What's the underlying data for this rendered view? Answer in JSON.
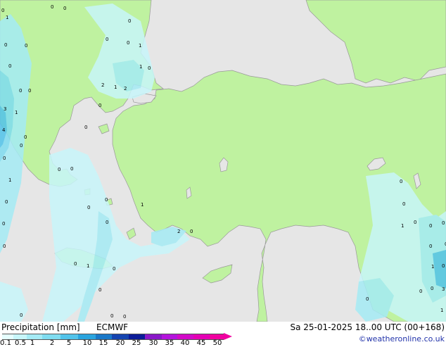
{
  "title": "Precipitation [mm]",
  "model": "ECMWF",
  "valid_time": "Sa 25-01-2025 18..00 UTC (00+168)",
  "credit": "©weatheronline.co.uk",
  "legend": {
    "ticks": [
      "0.1",
      "0.5",
      "1",
      "2",
      "5",
      "10",
      "15",
      "20",
      "25",
      "30",
      "35",
      "40",
      "45",
      "50"
    ],
    "colors": [
      "#e6ffff",
      "#c8f6fa",
      "#a5ebf5",
      "#7fdcf0",
      "#52c3ea",
      "#2aa4de",
      "#1a78c8",
      "#1544b0",
      "#0c1c98",
      "#8a18c8",
      "#b414dc",
      "#d20ac8",
      "#e400b4",
      "#f000a0"
    ]
  },
  "map_labels": [
    {
      "t": "0"
    },
    {
      "t": "0"
    },
    {
      "t": "1"
    },
    {
      "t": "0"
    },
    {
      "t": "0"
    },
    {
      "t": "0"
    },
    {
      "t": "1"
    },
    {
      "t": "0"
    },
    {
      "t": "0"
    },
    {
      "t": "0"
    },
    {
      "t": "1"
    },
    {
      "t": "0"
    },
    {
      "t": "2"
    },
    {
      "t": "1"
    },
    {
      "t": "2"
    },
    {
      "t": "0"
    },
    {
      "t": "3"
    },
    {
      "t": "1"
    },
    {
      "t": "4"
    },
    {
      "t": "0"
    },
    {
      "t": "0"
    },
    {
      "t": "0"
    },
    {
      "t": "0"
    },
    {
      "t": "1"
    },
    {
      "t": "0"
    },
    {
      "t": "0"
    },
    {
      "t": "0"
    },
    {
      "t": "0"
    },
    {
      "t": "0"
    },
    {
      "t": "0"
    },
    {
      "t": "0"
    },
    {
      "t": "0"
    },
    {
      "t": "1"
    },
    {
      "t": "1"
    },
    {
      "t": "0"
    },
    {
      "t": "0"
    },
    {
      "t": "2"
    },
    {
      "t": "0"
    },
    {
      "t": "0"
    },
    {
      "t": "0"
    },
    {
      "t": "1"
    },
    {
      "t": "0"
    },
    {
      "t": "0"
    },
    {
      "t": "0"
    },
    {
      "t": "0"
    },
    {
      "t": "0"
    },
    {
      "t": "0"
    },
    {
      "t": "0"
    },
    {
      "t": "0"
    },
    {
      "t": "0"
    },
    {
      "t": "0"
    },
    {
      "t": "0"
    },
    {
      "t": "0"
    },
    {
      "t": "0"
    },
    {
      "t": "3"
    },
    {
      "t": "1"
    },
    {
      "t": "0"
    },
    {
      "t": "0"
    },
    {
      "t": "1"
    },
    {
      "t": "0"
    }
  ]
}
